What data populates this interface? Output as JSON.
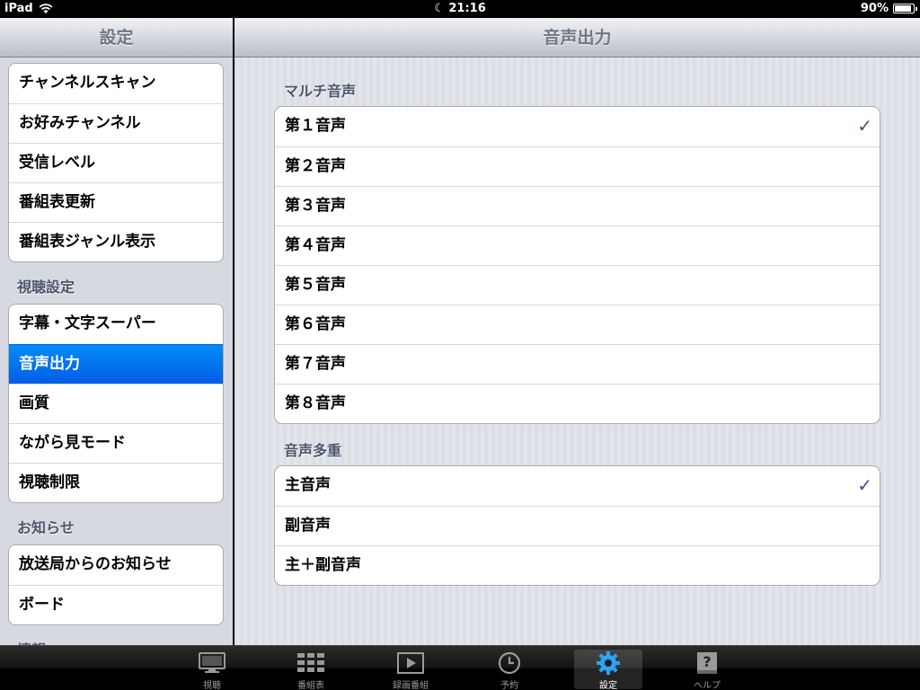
{
  "status": {
    "device": "iPad",
    "time": "21:16",
    "battery": "90%",
    "battery_level": 0.9
  },
  "sidebar": {
    "title": "設定",
    "group1": [
      "チャンネルスキャン",
      "お好みチャンネル",
      "受信レベル",
      "番組表更新",
      "番組表ジャンル表示"
    ],
    "section2": "視聴設定",
    "group2": [
      "字幕・文字スーパー",
      "音声出力",
      "画質",
      "ながら見モード",
      "視聴制限"
    ],
    "section3": "お知らせ",
    "group3": [
      "放送局からのお知らせ",
      "ボード"
    ],
    "section4": "情報"
  },
  "main": {
    "title": "音声出力",
    "section1": "マルチ音声",
    "multi": [
      "第１音声",
      "第２音声",
      "第３音声",
      "第４音声",
      "第５音声",
      "第６音声",
      "第７音声",
      "第８音声"
    ],
    "section2": "音声多重",
    "dual": [
      "主音声",
      "副音声",
      "主＋副音声"
    ],
    "check": "✓"
  },
  "tabs": [
    "視聴",
    "番組表",
    "録画番組",
    "予約",
    "設定",
    "ヘルプ"
  ],
  "colors": {
    "selected": "#0a6ff0",
    "check": "#385487"
  }
}
